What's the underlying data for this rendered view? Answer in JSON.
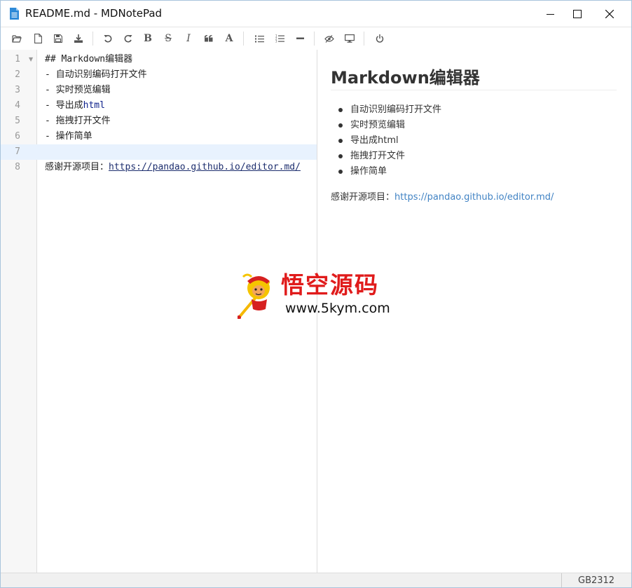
{
  "window": {
    "title": "README.md - MDNotePad",
    "icon": "document-icon",
    "controls": [
      "minimize-icon",
      "maximize-icon",
      "close-icon"
    ]
  },
  "toolbar": {
    "items": [
      {
        "name": "open-file",
        "icon": "folder-open-icon"
      },
      {
        "name": "new-file",
        "icon": "new-file-icon"
      },
      {
        "name": "save",
        "icon": "save-icon"
      },
      {
        "name": "export",
        "icon": "download-icon"
      },
      {
        "name": "undo",
        "icon": "undo-icon"
      },
      {
        "name": "redo",
        "icon": "redo-icon"
      },
      {
        "name": "bold",
        "label": "B"
      },
      {
        "name": "strikethrough",
        "label": "S"
      },
      {
        "name": "italic",
        "label": "I"
      },
      {
        "name": "quote",
        "icon": "quote-icon"
      },
      {
        "name": "uppercase",
        "label": "A"
      },
      {
        "name": "unordered-list",
        "icon": "list-ul-icon"
      },
      {
        "name": "ordered-list",
        "icon": "list-ol-icon"
      },
      {
        "name": "horizontal-rule",
        "icon": "minus-icon"
      },
      {
        "name": "toggle-preview",
        "icon": "eye-slash-icon"
      },
      {
        "name": "full-screen-preview",
        "icon": "desktop-icon"
      },
      {
        "name": "exit",
        "icon": "power-icon"
      }
    ]
  },
  "editor": {
    "line_numbers": [
      "1",
      "2",
      "3",
      "4",
      "5",
      "6",
      "7",
      "8"
    ],
    "lines": {
      "l1": "## Markdown编辑器",
      "l2": "- 自动识别编码打开文件",
      "l3": "- 实时预览编辑",
      "l4_prefix": "- 导出成",
      "l4_html": "html",
      "l5": "- 拖拽打开文件",
      "l6": "- 操作简单",
      "l7": "",
      "l8_prefix": "感谢开源项目：",
      "l8_url": "https://pandao.github.io/editor.md/"
    },
    "active_line": 7
  },
  "preview": {
    "heading": "Markdown编辑器",
    "list": [
      "自动识别编码打开文件",
      "实时预览编辑",
      "导出成html",
      "拖拽打开文件",
      "操作简单"
    ],
    "thanks_prefix": "感谢开源项目：",
    "thanks_link": "https://pandao.github.io/editor.md/"
  },
  "watermark": {
    "cn": "悟空源码",
    "url": "www.5kym.com"
  },
  "statusbar": {
    "encoding": "GB2312"
  },
  "colors": {
    "accent": "#2e8ad8",
    "link": "#4183c4",
    "active_line": "#e8f2fe",
    "watermark_red": "#e01b1b"
  }
}
